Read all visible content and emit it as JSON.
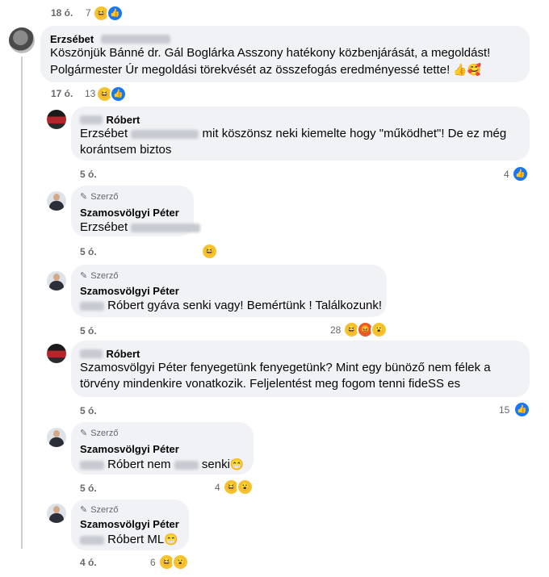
{
  "comments": [
    {
      "id": "c0",
      "time": "18 ó.",
      "reaction_count": "7",
      "reactions": [
        "haha-icon",
        "like-icon"
      ]
    },
    {
      "id": "c1",
      "author": "Erzsébet",
      "text": "Köszönjük Bánné dr. Gál Boglárka Asszony hatékony közbenjárását, a megoldást! Polgármester Úr megoldási törekvését az összefogás eredményessé tette!",
      "emoji": "👍🥰",
      "time": "17 ó.",
      "reaction_count": "13",
      "reactions": [
        "haha-icon",
        "like-icon"
      ]
    },
    {
      "id": "c2",
      "author": "Róbert",
      "text_prefix": "Erzsébet",
      "text": "mit köszönsz neki kiemelte hogy \"működhet\"! De ez még korántsem biztos",
      "time": "5 ó.",
      "reaction_count": "4",
      "reactions": [
        "like-icon"
      ]
    },
    {
      "id": "c3",
      "badge": "Szerző",
      "author": "Szamosvölgyi Péter",
      "text": "Erzsébet",
      "time": "5 ó.",
      "reactions": [
        "haha-icon"
      ]
    },
    {
      "id": "c4",
      "badge": "Szerző",
      "author": "Szamosvölgyi Péter",
      "text": "Róbert gyáva senki vagy! Bemértünk ! Találkozunk!",
      "time": "5 ó.",
      "reaction_count": "28",
      "reactions": [
        "haha-icon",
        "angry-icon",
        "wow-icon"
      ]
    },
    {
      "id": "c5",
      "author": "Róbert",
      "text": "Szamosvölgyi Péter fenyegetünk fenyegetünk? Mint egy bünöző nem félek a törvény mindenkire vonatkozik. Feljelentést meg fogom tenni fideSS es",
      "time": "5 ó.",
      "reaction_count": "15",
      "reactions": [
        "like-icon"
      ]
    },
    {
      "id": "c6",
      "badge": "Szerző",
      "author": "Szamosvölgyi Péter",
      "text_a": "Róbert nem",
      "text_b": "senki",
      "emoji": "😁",
      "time": "5 ó.",
      "reaction_count": "4",
      "reactions": [
        "haha-icon",
        "wow-icon"
      ]
    },
    {
      "id": "c7",
      "badge": "Szerző",
      "author": "Szamosvölgyi Péter",
      "text": "Róbert ML",
      "emoji": "😁",
      "time": "4 ó.",
      "reaction_count": "6",
      "reactions": [
        "haha-icon",
        "wow-icon"
      ]
    }
  ],
  "colors": {
    "bubble": "#f0f2f5",
    "like": "#1877f2",
    "haha": "#f7c22f",
    "angry": "#e9572a",
    "meta": "#65676b"
  }
}
